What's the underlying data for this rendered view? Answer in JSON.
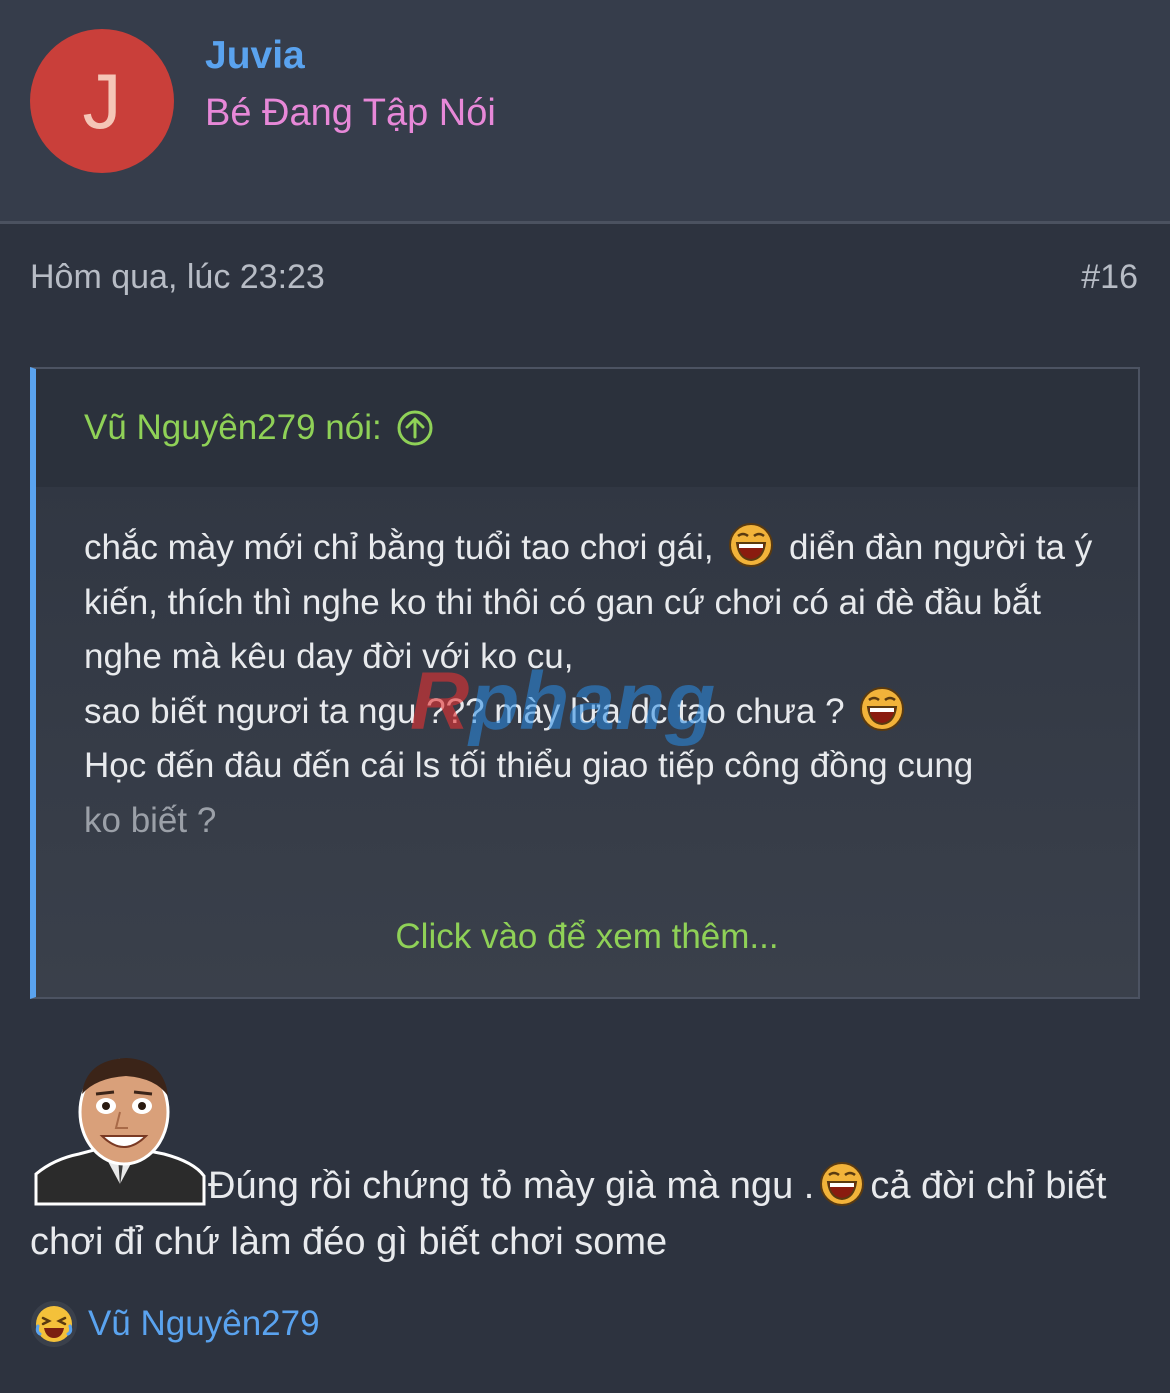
{
  "user": {
    "avatar_letter": "J",
    "name": "Juvia",
    "title": "Bé Đang Tập Nói"
  },
  "post": {
    "timestamp": "Hôm qua, lúc 23:23",
    "number": "#16",
    "body_text": "Đúng rồi chứng tỏ mày già mà ngu .",
    "body_text_2": "cả đời chỉ biết chơi đỉ chứ làm đéo gì biết chơi some",
    "sticker_icon": "meme-face-sticker"
  },
  "quote": {
    "author": "Vũ Nguyên279 nói:",
    "lines": [
      "chắc mày mới chỉ bằng tuổi tao chơi gái, ",
      " diển đàn người ta ý kiến, thích thì nghe ko thi thôi có gan cứ chơi có ai đè đầu bắt nghe mà kêu day đời với ko cu,",
      "sao biết ngươi ta ngu ??? mày lừa dc tao chưa ? ",
      "Học đến đâu đến cái ls tối thiểu giao tiếp công đồng cung",
      "ko biết ?"
    ],
    "expand_label": "Click vào để xem thêm..."
  },
  "reaction": {
    "icon": "laughing-emoji-icon",
    "user": "Vũ Nguyên279"
  },
  "watermark": {
    "first_letter": "R",
    "rest": "phang"
  },
  "colors": {
    "link_blue": "#5aa3ef",
    "quote_green": "#8fd157",
    "title_pink": "#e788d8",
    "avatar_red": "#c93f3a"
  }
}
